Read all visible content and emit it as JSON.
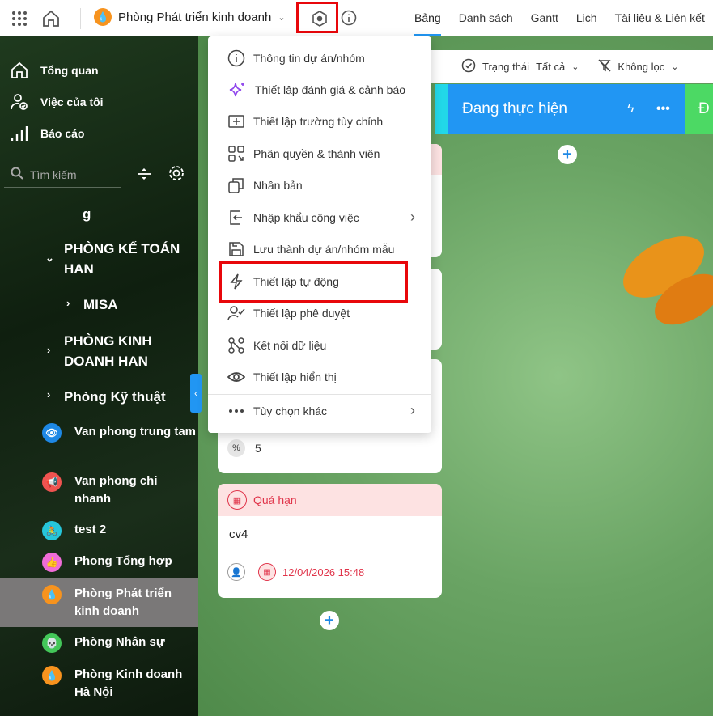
{
  "header": {
    "project_name": "Phòng Phát triển kinh doanh",
    "tabs": [
      "Bảng",
      "Danh sách",
      "Gantt",
      "Lịch",
      "Tài liệu & Liên kết"
    ],
    "active_tab": "Bảng"
  },
  "sidebar": {
    "nav": [
      {
        "label": "Tổng quan",
        "icon": "home-icon"
      },
      {
        "label": "Việc của tôi",
        "icon": "user-check-icon"
      },
      {
        "label": "Báo cáo",
        "icon": "bar-chart-icon"
      }
    ],
    "search_placeholder": "Tìm kiếm",
    "tree": [
      "g",
      "PHÒNG KẾ TOÁN HAN",
      "MISA",
      "PHÒNG KINH DOANH HAN",
      "Phòng Kỹ thuật"
    ],
    "projects": [
      {
        "label": "Van phong trung tam",
        "color": "#1e88e5",
        "icon": "eye-icon"
      },
      {
        "label": "Van phong chi nhanh",
        "color": "#ef5350",
        "icon": "megaphone-icon"
      },
      {
        "label": "test 2",
        "color": "#26c6da",
        "icon": "cyclist-icon"
      },
      {
        "label": "Phong Tổng hợp",
        "color": "#f06cd8",
        "icon": "thumbs-up-icon"
      },
      {
        "label": "Phòng Phát triển kinh doanh",
        "color": "#f7931e",
        "icon": "drop-icon",
        "selected": true
      },
      {
        "label": "Phòng Nhân sự",
        "color": "#43c659",
        "icon": "skull-icon"
      },
      {
        "label": "Phòng Kinh doanh Hà Nội",
        "color": "#f7931e",
        "icon": "drop-icon"
      }
    ]
  },
  "toolbar": {
    "status_label": "Trạng thái",
    "status_value": "Tất cả",
    "filter_label": "Không lọc"
  },
  "columns": [
    {
      "title": "Đang thực hiện",
      "color": "#2196f3"
    }
  ],
  "cards": [
    {
      "progress": "5"
    },
    {
      "status": "Quá hạn",
      "title": "cv4",
      "due": "12/04/2026 15:48"
    }
  ],
  "menu": {
    "items": [
      "Thông tin dự án/nhóm",
      "Thiết lập đánh giá & cảnh báo",
      "Thiết lập trường tùy chỉnh",
      "Phân quyền & thành viên",
      "Nhân bản",
      "Nhập khẩu công việc",
      "Lưu thành dự án/nhóm mẫu",
      "Thiết lập tự động",
      "Thiết lập phê duyệt",
      "Kết nối dữ liệu",
      "Thiết lập hiển thị",
      "Tùy chọn khác"
    ],
    "highlighted": "Thiết lập tự động"
  }
}
